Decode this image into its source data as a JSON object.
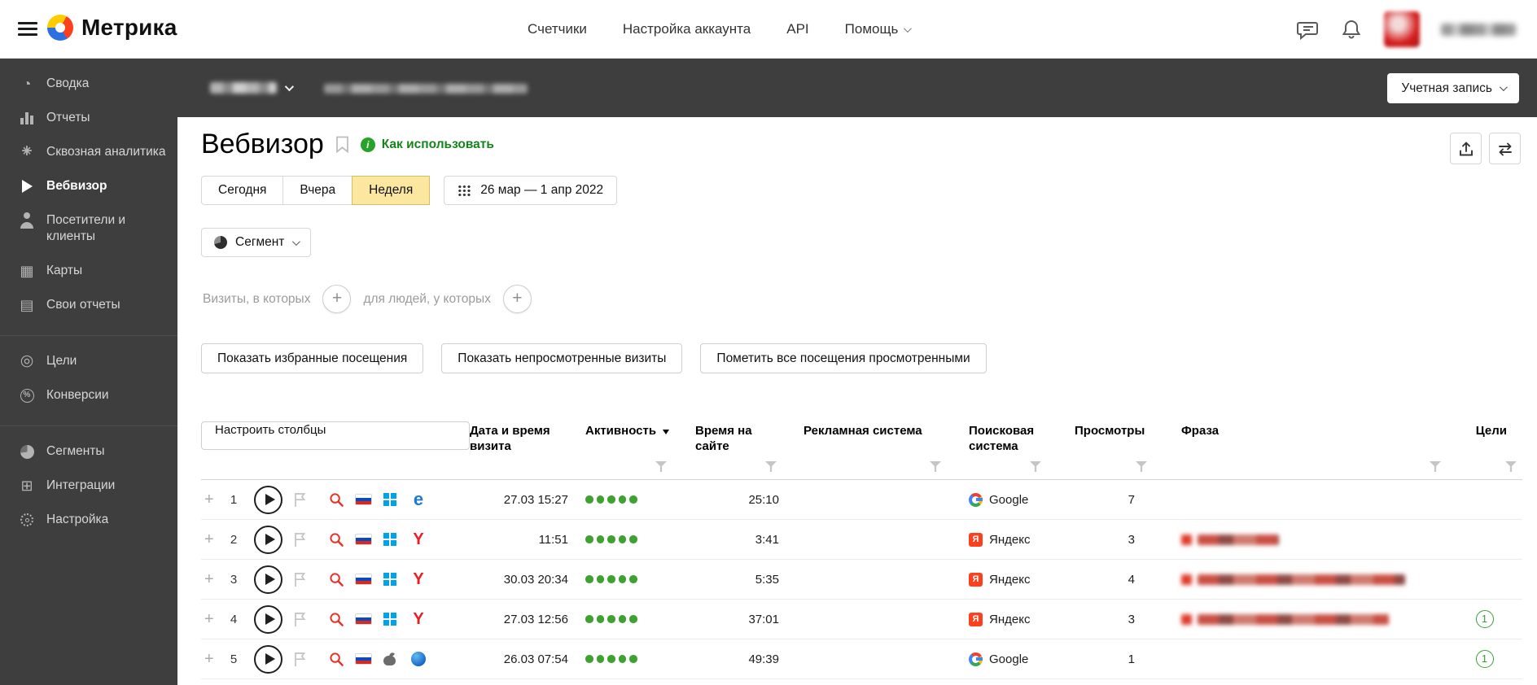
{
  "header": {
    "logo_text": "Метрика",
    "nav_items": [
      "Счетчики",
      "Настройка аккаунта",
      "API",
      "Помощь"
    ]
  },
  "topbar": {
    "account_button": "Учетная запись"
  },
  "sidebar": {
    "items": [
      {
        "label": "Сводка",
        "icon": "gauge-icon",
        "active": false
      },
      {
        "label": "Отчеты",
        "icon": "bar-chart-icon",
        "active": false
      },
      {
        "label": "Сквозная аналитика",
        "icon": "asterisk-icon",
        "active": false
      },
      {
        "label": "Вебвизор",
        "icon": "play-icon",
        "active": true
      },
      {
        "label": "Посетители и клиенты",
        "icon": "person-icon",
        "active": false
      },
      {
        "label": "Карты",
        "icon": "grid-icon",
        "active": false
      },
      {
        "label": "Свои отчеты",
        "icon": "document-icon",
        "active": false
      },
      {
        "label": "Цели",
        "icon": "target-icon",
        "active": false
      },
      {
        "label": "Конверсии",
        "icon": "percent-icon",
        "active": false
      },
      {
        "label": "Сегменты",
        "icon": "pie-icon",
        "active": false
      },
      {
        "label": "Интеграции",
        "icon": "integrations-icon",
        "active": false
      },
      {
        "label": "Настройка",
        "icon": "gear-icon",
        "active": false
      }
    ]
  },
  "page": {
    "title": "Вебвизор",
    "how_to_use": "Как использовать",
    "tabs": [
      "Сегодня",
      "Вчера",
      "Неделя"
    ],
    "active_tab": "Неделя",
    "date_range": "26 мар — 1 апр 2022",
    "segment_button": "Сегмент",
    "visits_hint": "Визиты, в которых",
    "people_hint": "для людей, у которых",
    "btn_favorites": "Показать избранные посещения",
    "btn_unviewed": "Показать непросмотренные визиты",
    "btn_mark_viewed": "Пометить все посещения просмотренными",
    "btn_columns": "Настроить столбцы"
  },
  "icons": {
    "edge_letter": "e",
    "yandex_browser_letter": "Y",
    "yandex_search_letter": "Я",
    "info_letter": "i"
  },
  "table": {
    "columns": {
      "datetime": "Дата и время визита",
      "activity": "Активность",
      "time_on_site": "Время на сайте",
      "ad_system": "Рекламная система",
      "search_engine": "Поисковая система",
      "views": "Просмотры",
      "phrase": "Фраза",
      "goals": "Цели"
    },
    "rows": [
      {
        "num": "1",
        "datetime": "27.03 15:27",
        "activity_dots": 5,
        "time_on_site": "25:10",
        "ad_system": "",
        "search_engine": "Google",
        "views": "7",
        "phrase_redacted": false,
        "goals": "",
        "os": "windows",
        "browser": "edge"
      },
      {
        "num": "2",
        "datetime": "11:51",
        "activity_dots": 5,
        "time_on_site": "3:41",
        "ad_system": "",
        "search_engine": "Яндекс",
        "views": "3",
        "phrase_redacted": true,
        "goals": "",
        "os": "windows",
        "browser": "yandex"
      },
      {
        "num": "3",
        "datetime": "30.03 20:34",
        "activity_dots": 5,
        "time_on_site": "5:35",
        "ad_system": "",
        "search_engine": "Яндекс",
        "views": "4",
        "phrase_redacted": true,
        "goals": "",
        "os": "windows",
        "browser": "yandex"
      },
      {
        "num": "4",
        "datetime": "27.03 12:56",
        "activity_dots": 5,
        "time_on_site": "37:01",
        "ad_system": "",
        "search_engine": "Яндекс",
        "views": "3",
        "phrase_redacted": true,
        "goals": "1",
        "os": "windows",
        "browser": "yandex"
      },
      {
        "num": "5",
        "datetime": "26.03 07:54",
        "activity_dots": 5,
        "time_on_site": "49:39",
        "ad_system": "",
        "search_engine": "Google",
        "views": "1",
        "phrase_redacted": false,
        "goals": "1",
        "os": "apple",
        "browser": "safari"
      }
    ]
  }
}
